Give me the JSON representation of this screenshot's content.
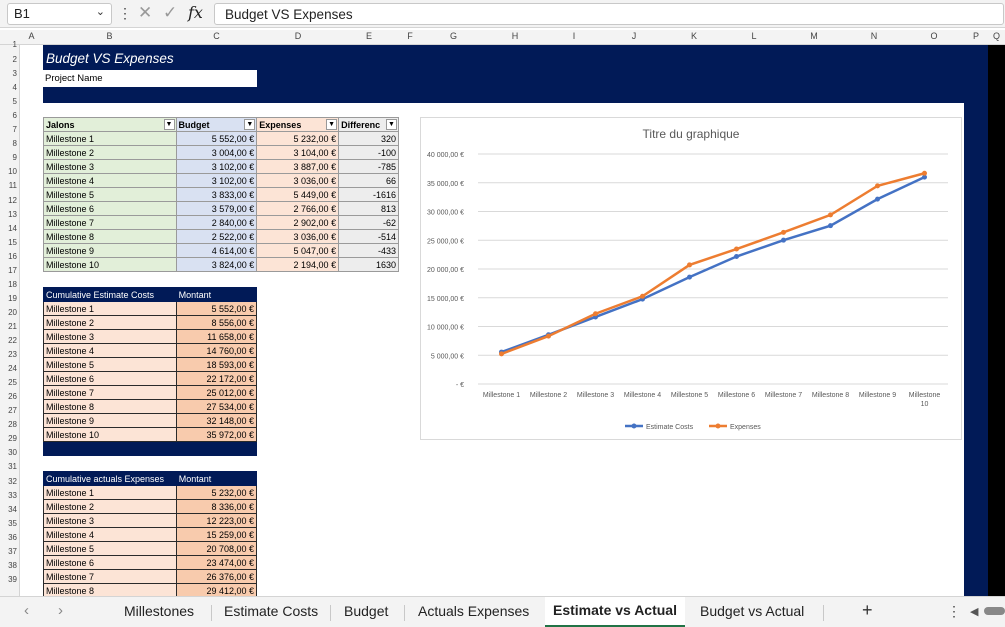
{
  "formula_bar": {
    "name_box": "B1",
    "fx": "fx",
    "formula": "Budget VS Expenses"
  },
  "columns": [
    "A",
    "B",
    "C",
    "D",
    "E",
    "F",
    "G",
    "H",
    "I",
    "J",
    "K",
    "L",
    "M",
    "N",
    "O",
    "P",
    "Q"
  ],
  "rows": [
    "1",
    "2",
    "3",
    "4",
    "5",
    "6",
    "7",
    "8",
    "9",
    "10",
    "11",
    "12",
    "13",
    "14",
    "15",
    "16",
    "17",
    "18",
    "19",
    "20",
    "21",
    "22",
    "23",
    "24",
    "25",
    "26",
    "27",
    "28",
    "29",
    "30",
    "31",
    "32",
    "33",
    "34",
    "35",
    "36",
    "37",
    "38",
    "39"
  ],
  "sheet": {
    "title": "Budget VS Expenses",
    "project_name": "Project Name"
  },
  "table1": {
    "headers": [
      "Jalons",
      "Budget",
      "Expenses",
      "Differenc"
    ],
    "rows": [
      [
        "Millestone 1",
        "5 552,00 €",
        "5 232,00 €",
        "320"
      ],
      [
        "Millestone 2",
        "3 004,00 €",
        "3 104,00 €",
        "-100"
      ],
      [
        "Millestone 3",
        "3 102,00 €",
        "3 887,00 €",
        "-785"
      ],
      [
        "Millestone 4",
        "3 102,00 €",
        "3 036,00 €",
        "66"
      ],
      [
        "Millestone 5",
        "3 833,00 €",
        "5 449,00 €",
        "-1616"
      ],
      [
        "Millestone 6",
        "3 579,00 €",
        "2 766,00 €",
        "813"
      ],
      [
        "Millestone 7",
        "2 840,00 €",
        "2 902,00 €",
        "-62"
      ],
      [
        "Millestone 8",
        "2 522,00 €",
        "3 036,00 €",
        "-514"
      ],
      [
        "Millestone 9",
        "4 614,00 €",
        "5 047,00 €",
        "-433"
      ],
      [
        "Millestone 10",
        "3 824,00 €",
        "2 194,00 €",
        "1630"
      ]
    ]
  },
  "table2": {
    "headers": [
      "Cumulative Estimate Costs",
      "Montant"
    ],
    "rows": [
      [
        "Millestone 1",
        "5 552,00 €"
      ],
      [
        "Millestone 2",
        "8 556,00 €"
      ],
      [
        "Millestone 3",
        "11 658,00 €"
      ],
      [
        "Millestone 4",
        "14 760,00 €"
      ],
      [
        "Millestone 5",
        "18 593,00 €"
      ],
      [
        "Millestone 6",
        "22 172,00 €"
      ],
      [
        "Millestone 7",
        "25 012,00 €"
      ],
      [
        "Millestone 8",
        "27 534,00 €"
      ],
      [
        "Millestone 9",
        "32 148,00 €"
      ],
      [
        "Millestone 10",
        "35 972,00 €"
      ]
    ]
  },
  "table3": {
    "headers": [
      "Cumulative actuals Expenses",
      "Montant"
    ],
    "rows": [
      [
        "Millestone 1",
        "5 232,00 €"
      ],
      [
        "Millestone 2",
        "8 336,00 €"
      ],
      [
        "Millestone 3",
        "12 223,00 €"
      ],
      [
        "Millestone 4",
        "15 259,00 €"
      ],
      [
        "Millestone 5",
        "20 708,00 €"
      ],
      [
        "Millestone 6",
        "23 474,00 €"
      ],
      [
        "Millestone 7",
        "26 376,00 €"
      ],
      [
        "Millestone 8",
        "29 412,00 €"
      ]
    ]
  },
  "chart_data": {
    "type": "line",
    "title": "Titre du graphique",
    "categories": [
      "Millestone 1",
      "Millestone 2",
      "Millestone 3",
      "Millestone 4",
      "Millestone 5",
      "Millestone 6",
      "Millestone 7",
      "Millestone 8",
      "Millestone 9",
      "Millestone 10"
    ],
    "series": [
      {
        "name": "Estimate Costs",
        "color": "#4472c4",
        "values": [
          5552,
          8556,
          11658,
          14760,
          18593,
          22172,
          25012,
          27534,
          32148,
          35972
        ]
      },
      {
        "name": "Expenses",
        "color": "#ed7d31",
        "values": [
          5232,
          8336,
          12223,
          15259,
          20708,
          23474,
          26376,
          29412,
          34459,
          36653
        ]
      }
    ],
    "y_ticks": [
      "-   €",
      "5 000,00 €",
      "10 000,00 €",
      "15 000,00 €",
      "20 000,00 €",
      "25 000,00 €",
      "30 000,00 €",
      "35 000,00 €",
      "40 000,00 €"
    ],
    "ylim": [
      0,
      40000
    ],
    "grid": true,
    "legend": "bottom"
  },
  "tabs": {
    "items": [
      "Millestones",
      "Estimate Costs",
      "Budget",
      "Actuals Expenses",
      "Estimate vs Actual",
      "Budget vs Actual"
    ],
    "active": "Estimate vs Actual",
    "add": "+"
  }
}
